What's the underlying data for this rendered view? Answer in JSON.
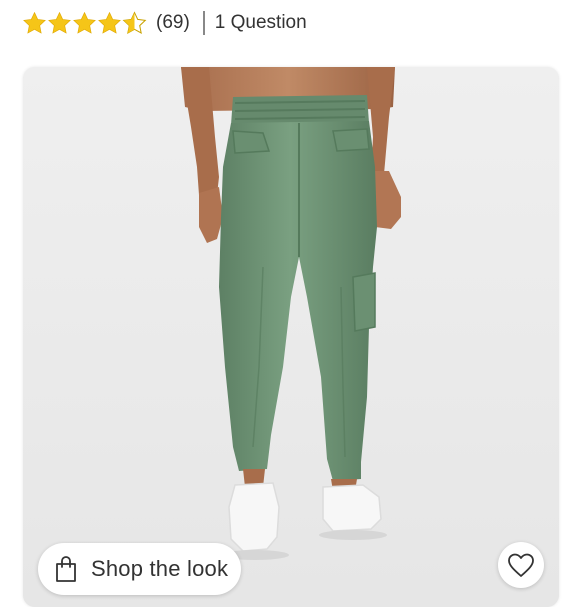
{
  "rating": {
    "value": 4.5,
    "max": 5,
    "review_count": "(69)",
    "questions_link": "1 Question"
  },
  "colors": {
    "star": "#f5c518",
    "pants": "#6d9274",
    "background": "#ececec",
    "text": "#333333"
  },
  "product_image": {
    "icon": "product-photo"
  },
  "shop_look": {
    "label": "Shop the look",
    "icon": "shopping-bag-icon"
  },
  "favorite": {
    "icon": "heart-icon"
  }
}
